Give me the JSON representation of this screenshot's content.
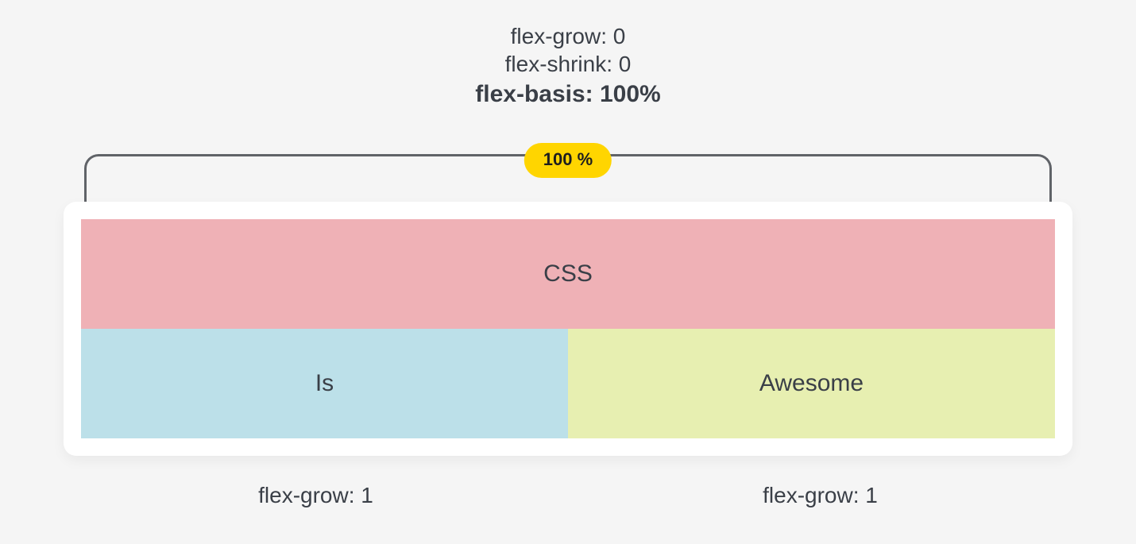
{
  "top": {
    "line1": "flex-grow: 0",
    "line2": "flex-shrink: 0",
    "line3": "flex-basis: 100%"
  },
  "badge": {
    "label": "100 %"
  },
  "items": {
    "a": {
      "label": "CSS"
    },
    "b": {
      "label": "Is"
    },
    "c": {
      "label": "Awesome"
    }
  },
  "bottom": {
    "left": "flex-grow: 1",
    "right": "flex-grow: 1"
  },
  "colors": {
    "red": "#efb1b6",
    "blue": "#bce0e9",
    "green": "#e7efb1",
    "badge": "#ffd500",
    "page_bg": "#f5f5f5",
    "card_bg": "#ffffff",
    "stroke": "#606368",
    "text": "#3a3f47"
  }
}
